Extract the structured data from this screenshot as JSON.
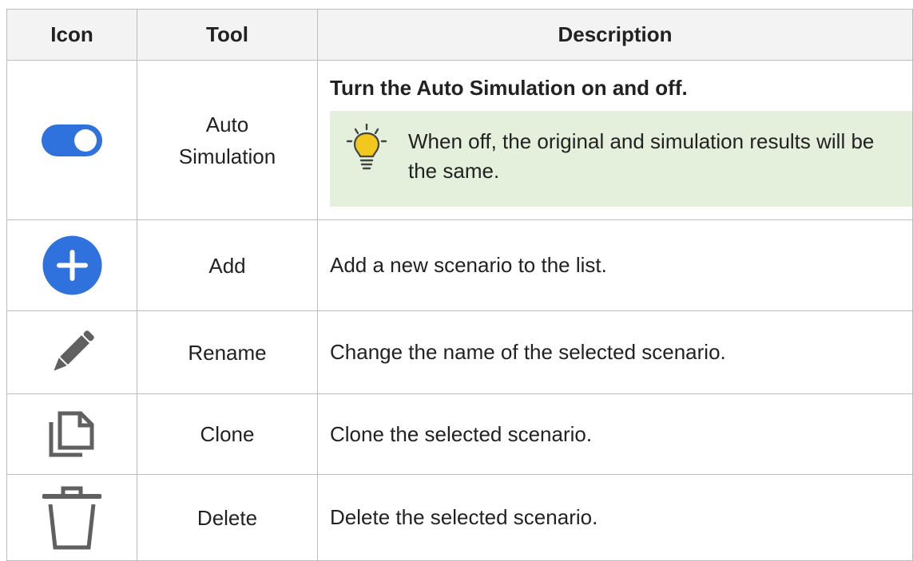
{
  "table": {
    "headers": {
      "icon": "Icon",
      "tool": "Tool",
      "description": "Description"
    },
    "rows": [
      {
        "icon": "toggle-switch-icon",
        "tool": "Auto Simulation",
        "description_title": "Turn the Auto Simulation on and off.",
        "tip": {
          "icon": "lightbulb-icon",
          "text": "When off, the original and simulation results will be the same."
        }
      },
      {
        "icon": "add-circle-icon",
        "tool": "Add",
        "description": "Add a new scenario to the list."
      },
      {
        "icon": "pencil-icon",
        "tool": "Rename",
        "description": "Change the name of the selected scenario."
      },
      {
        "icon": "copy-icon",
        "tool": "Clone",
        "description": "Clone the selected scenario."
      },
      {
        "icon": "trash-icon",
        "tool": "Delete",
        "description": "Delete the selected scenario."
      }
    ]
  },
  "colors": {
    "accent_blue": "#2f72dd",
    "icon_gray": "#606060",
    "tip_background": "#e4f0db",
    "bulb_yellow": "#f2c81e",
    "border": "#bdbdbd"
  }
}
